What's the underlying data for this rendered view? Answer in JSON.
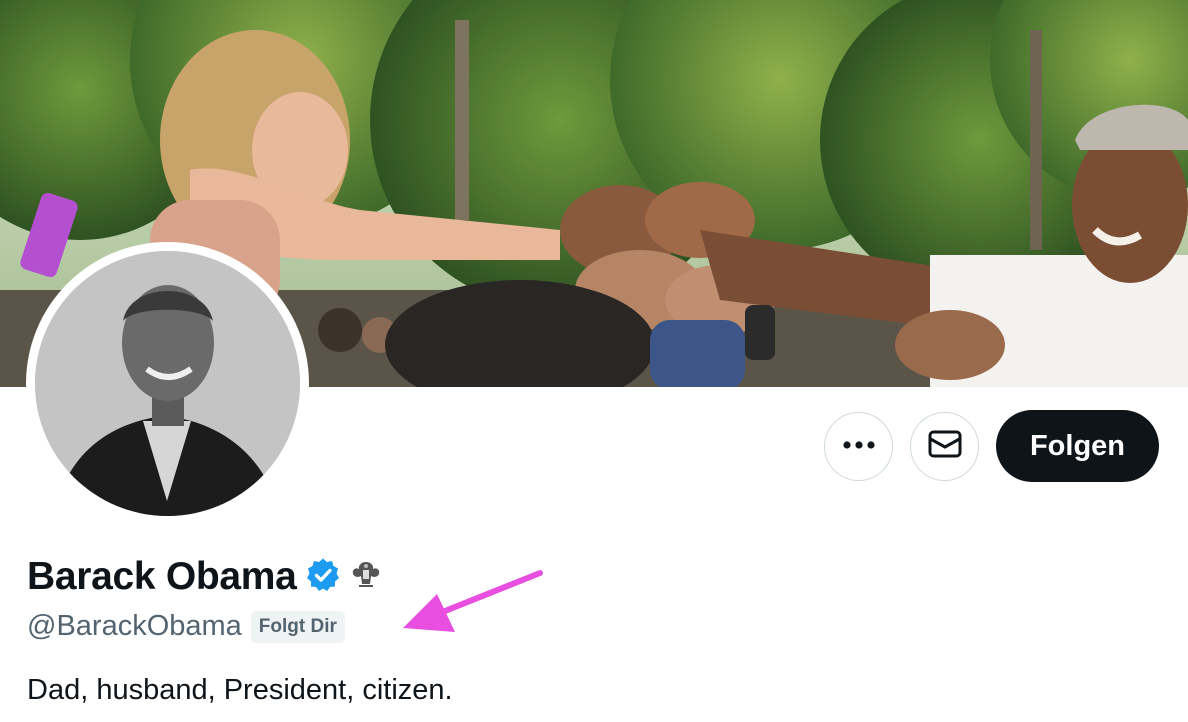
{
  "profile": {
    "display_name": "Barack Obama",
    "handle": "@BarackObama",
    "follows_you_badge": "Folgt Dir",
    "bio": "Dad, husband, President, citizen.",
    "verified_badge_icon": "verified-checkmark-icon",
    "affiliation_badge_icon": "presidential-seal-icon"
  },
  "actions": {
    "more_icon": "more-dots-icon",
    "message_icon": "envelope-icon",
    "follow_label": "Folgen"
  },
  "colors": {
    "verified_blue": "#1d9bf0",
    "follow_button_bg": "#0f1419",
    "annotation_arrow": "#e84ee0",
    "secondary_text": "#536471"
  }
}
